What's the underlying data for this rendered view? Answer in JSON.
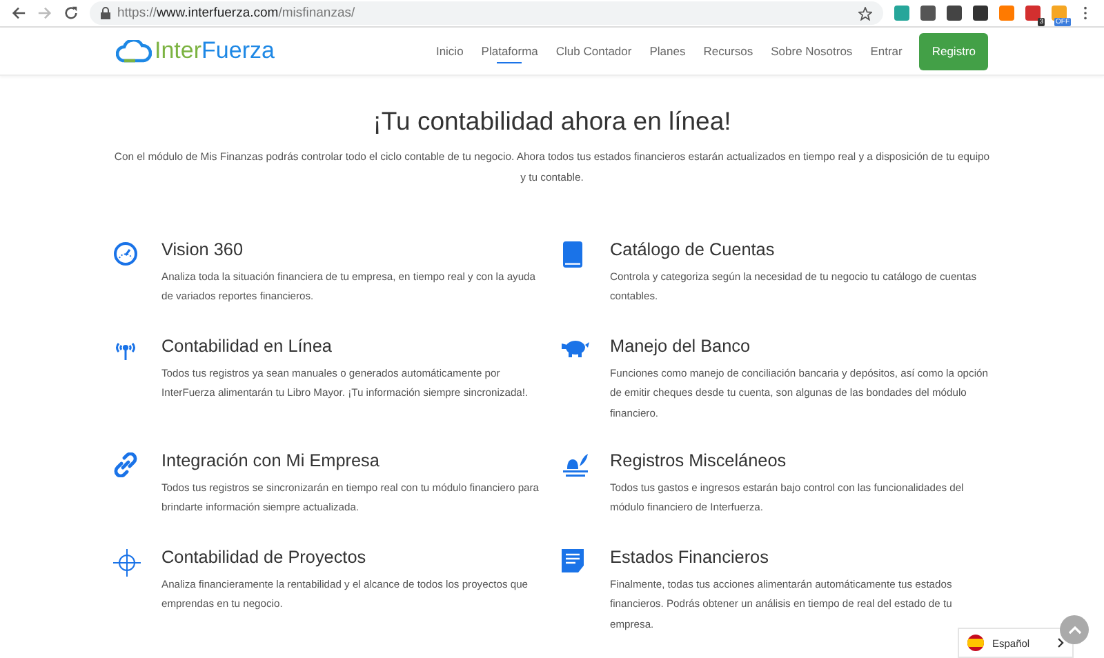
{
  "browser": {
    "url_scheme": "https://",
    "url_host": "www.interfuerza.com",
    "url_path": "/misfinanzas/",
    "extension_badges": [
      "3",
      "OFF"
    ]
  },
  "header": {
    "brand_first": "Inter",
    "brand_second": "Fuerza",
    "nav": [
      {
        "label": "Inicio",
        "selected": false
      },
      {
        "label": "Plataforma",
        "selected": true
      },
      {
        "label": "Club Contador",
        "selected": false
      },
      {
        "label": "Planes",
        "selected": false
      },
      {
        "label": "Recursos",
        "selected": false
      },
      {
        "label": "Sobre Nosotros",
        "selected": false
      },
      {
        "label": "Entrar",
        "selected": false
      }
    ],
    "cta": "Registro"
  },
  "hero": {
    "title": "¡Tu contabilidad ahora en línea!",
    "text": "Con el módulo de Mis Finanzas podrás controlar todo el ciclo contable de tu negocio. Ahora todos tus estados financieros estarán actualizados en tiempo real y a disposición de tu equipo y tu contable."
  },
  "features": [
    {
      "title": "Vision 360",
      "text": "Analiza toda la situación financiera de tu empresa, en tiempo real y con la ayuda de variados reportes financieros."
    },
    {
      "title": "Catálogo de Cuentas",
      "text": "Controla y categoriza según la necesidad de tu negocio tu catálogo de cuentas contables."
    },
    {
      "title": "Contabilidad en Línea",
      "text": "Todos tus registros ya sean manuales o generados automáticamente por InterFuerza alimentarán tu Libro Mayor. ¡Tu información siempre sincronizada!."
    },
    {
      "title": "Manejo del Banco",
      "text": "Funciones como manejo de conciliación bancaria y depósitos, así como la opción de emitir cheques desde tu cuenta, son algunas de las bondades del módulo financiero."
    },
    {
      "title": "Integración con Mi Empresa",
      "text": "Todos tus registros se sincronizarán en tiempo real con tu módulo financiero para brindarte información siempre actualizada."
    },
    {
      "title": "Registros Misceláneos",
      "text": "Todos tus gastos e ingresos estarán bajo control con las funcionalidades del módulo financiero de Interfuerza."
    },
    {
      "title": "Contabilidad de Proyectos",
      "text": "Analiza financieramente la rentabilidad y el alcance de todos los proyectos que emprendas en tu negocio."
    },
    {
      "title": "Estados Financieros",
      "text": "Finalmente, todas tus acciones alimentarán automáticamente tus estados financieros. Podrás obtener un análisis en tiempo de real del estado de tu empresa."
    }
  ],
  "language": {
    "label": "Español"
  }
}
